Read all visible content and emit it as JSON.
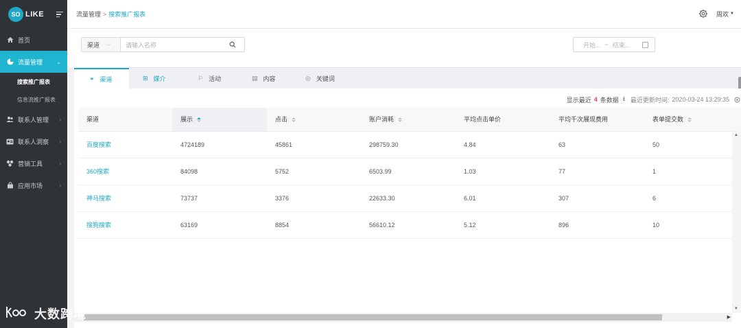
{
  "brand": {
    "badge": "SO",
    "name": "LIKE",
    "accent": "#1fa9c7"
  },
  "sidebar": {
    "items": [
      {
        "label": "首页",
        "icon": "home-icon"
      },
      {
        "label": "流量管理",
        "icon": "pie-chart-icon",
        "active": true
      },
      {
        "label": "联系人管理",
        "icon": "contacts-icon"
      },
      {
        "label": "联系人洞察",
        "icon": "id-card-icon"
      },
      {
        "label": "营销工具",
        "icon": "tools-icon"
      },
      {
        "label": "应用市场",
        "icon": "shop-icon"
      }
    ],
    "subitems": [
      {
        "label": "搜索推广报表",
        "active": true
      },
      {
        "label": "信息流推广报表"
      }
    ]
  },
  "header": {
    "breadcrumb": [
      "流量管理",
      "搜索推广报表"
    ],
    "breadcrumb_sep": ">",
    "user": "周欢"
  },
  "filters": {
    "select_value": "渠道",
    "search_placeholder": "请输入名称",
    "date_start": "开始...",
    "date_sep": "~",
    "date_end": "结束..."
  },
  "tabs": [
    {
      "label": "渠道",
      "icon": "link-icon"
    },
    {
      "label": "媒介",
      "icon": "grid-icon"
    },
    {
      "label": "活动",
      "icon": "flag-icon"
    },
    {
      "label": "内容",
      "icon": "document-icon"
    },
    {
      "label": "关键词",
      "icon": "tag-icon"
    }
  ],
  "info": {
    "prefix": "显示最近",
    "count": "4",
    "suffix": "条数据",
    "updated_label": "最近更新时间:",
    "updated_time": "2020-03-24 13:29:35"
  },
  "table": {
    "columns": [
      "渠道",
      "展示",
      "点击",
      "账户消耗",
      "平均点击单价",
      "平均千次展现费用",
      "表单提交数"
    ],
    "rows": [
      [
        "百度搜索",
        "4724189",
        "45861",
        "298759.30",
        "4.84",
        "63",
        "50"
      ],
      [
        "360搜索",
        "84098",
        "5752",
        "6503.99",
        "1.03",
        "77",
        "1"
      ],
      [
        "神马搜索",
        "73737",
        "3376",
        "22633.30",
        "6.01",
        "307",
        "6"
      ],
      [
        "搜狗搜索",
        "63169",
        "8854",
        "56610.12",
        "5.12",
        "896",
        "10"
      ]
    ]
  },
  "watermark": {
    "logo": "k-b-o-o",
    "text": "大数跨境"
  }
}
